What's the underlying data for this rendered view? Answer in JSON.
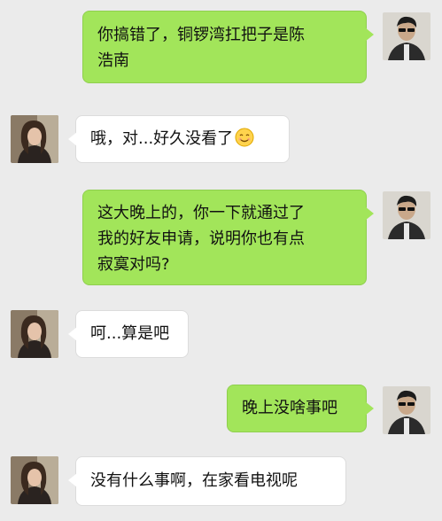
{
  "messages": [
    {
      "side": "out",
      "avatar": "man-sunglasses-avatar",
      "lines": [
        "你搞错了，铜锣湾扛把子是陈",
        "浩南"
      ]
    },
    {
      "side": "in",
      "avatar": "woman-avatar",
      "lines": [
        "哦，对...好久没看了"
      ],
      "emoji": "smile-emoji"
    },
    {
      "side": "out",
      "avatar": "man-sunglasses-avatar",
      "lines": [
        "这大晚上的，你一下就通过了",
        "我的好友申请，说明你也有点",
        "寂寞对吗?"
      ]
    },
    {
      "side": "in",
      "avatar": "woman-avatar",
      "lines": [
        "呵...算是吧"
      ]
    },
    {
      "side": "out",
      "avatar": "man-sunglasses-avatar",
      "lines": [
        "晚上没啥事吧"
      ]
    },
    {
      "side": "in",
      "avatar": "woman-avatar",
      "lines": [
        "没有什么事啊，在家看电视呢"
      ]
    }
  ],
  "colors": {
    "outgoing": "#a2e55a",
    "incoming": "#ffffff",
    "background": "#ebebeb"
  }
}
